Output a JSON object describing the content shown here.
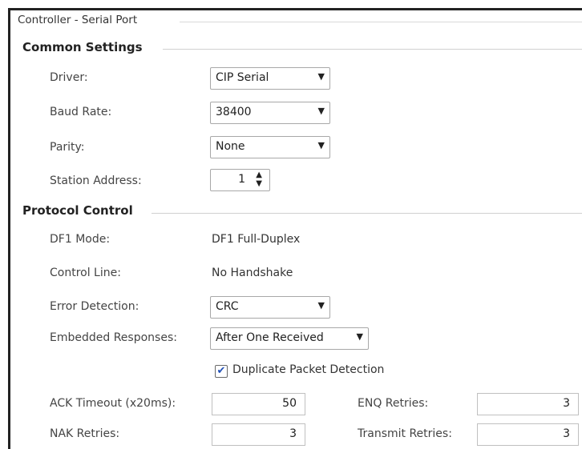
{
  "window": {
    "title": "Controller - Serial Port"
  },
  "common": {
    "heading": "Common Settings",
    "driver_label": "Driver:",
    "driver_value": "CIP Serial",
    "baud_label": "Baud Rate:",
    "baud_value": "38400",
    "parity_label": "Parity:",
    "parity_value": "None",
    "station_label": "Station Address:",
    "station_value": "1"
  },
  "protocol": {
    "heading": "Protocol Control",
    "df1_label": "DF1 Mode:",
    "df1_value": "DF1 Full-Duplex",
    "control_label": "Control Line:",
    "control_value": "No Handshake",
    "error_label": "Error Detection:",
    "error_value": "CRC",
    "embedded_label": "Embedded Responses:",
    "embedded_value": "After One Received",
    "duplicate_label": "Duplicate Packet Detection",
    "duplicate_checked": true,
    "ack_label": "ACK Timeout (x20ms):",
    "ack_value": "50",
    "enq_label": "ENQ Retries:",
    "enq_value": "3",
    "nak_label": "NAK Retries:",
    "nak_value": "3",
    "transmit_label": "Transmit Retries:",
    "transmit_value": "3"
  }
}
